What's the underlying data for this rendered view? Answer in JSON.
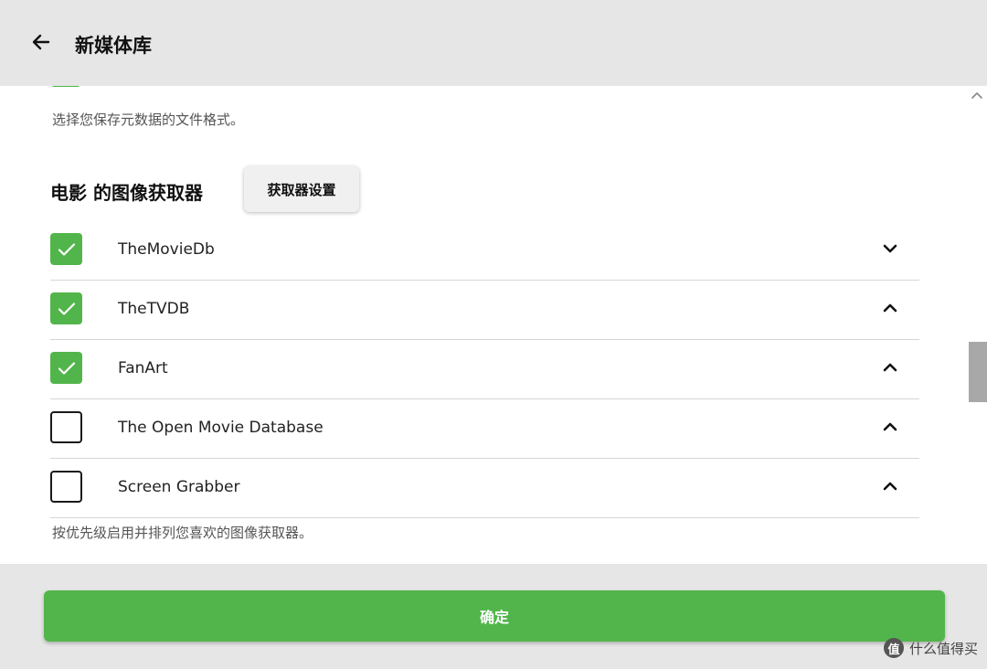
{
  "header": {
    "title": "新媒体库",
    "back_icon": "arrow-left-icon"
  },
  "content": {
    "metadata_hint": "选择您保存元数据的文件格式。",
    "section_title": "电影 的图像获取器",
    "settings_button_label": "获取器设置",
    "fetchers": [
      {
        "label": "TheMovieDb",
        "checked": true,
        "chevron": "chevron-down-icon"
      },
      {
        "label": "TheTVDB",
        "checked": true,
        "chevron": "chevron-up-icon"
      },
      {
        "label": "FanArt",
        "checked": true,
        "chevron": "chevron-up-icon"
      },
      {
        "label": "The Open Movie Database",
        "checked": false,
        "chevron": "chevron-up-icon"
      },
      {
        "label": "Screen Grabber",
        "checked": false,
        "chevron": "chevron-up-icon"
      }
    ],
    "fetcher_hint": "按优先级启用并排列您喜欢的图像获取器。"
  },
  "footer": {
    "confirm_label": "确定"
  },
  "watermark": {
    "text": "什么值得买",
    "logo_char": "值"
  },
  "colors": {
    "accent": "#52b54b",
    "header_bg": "#e6e6e6",
    "panel_bg": "#ffffff"
  }
}
